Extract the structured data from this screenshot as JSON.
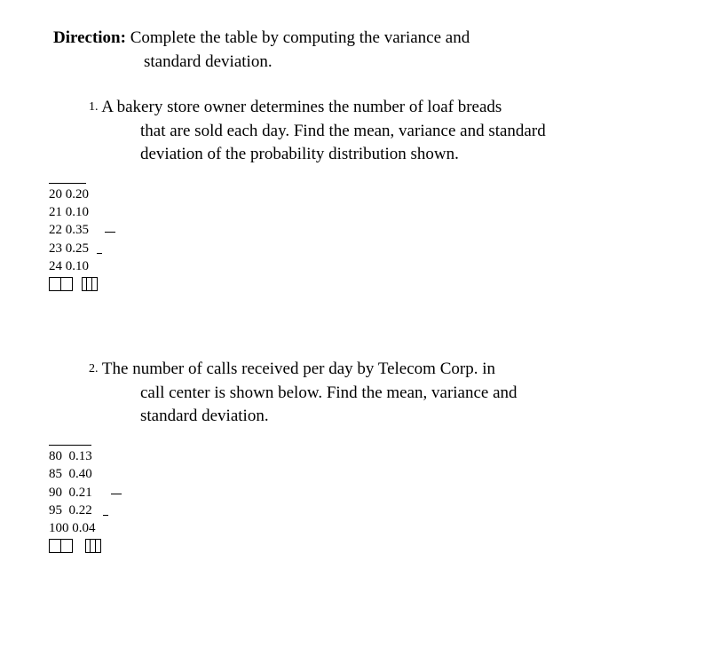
{
  "direction": {
    "label": "Direction:",
    "text1": " Complete the table by computing the variance and",
    "text2": "standard deviation."
  },
  "problems": [
    {
      "num": "1.",
      "text1": " A bakery store owner determines the number of loaf breads",
      "text2": "that are sold each day. Find the mean, variance and standard",
      "text3": "deviation of the probability distribution shown.",
      "data": [
        "20 0.20",
        "21 0.10",
        "22 0.35",
        "23 0.25",
        "24 0.10"
      ]
    },
    {
      "num": "2.",
      "text1": " The number of calls received per day by Telecom Corp. in",
      "text2": "call center is shown below. Find the mean, variance and",
      "text3": "standard deviation.",
      "data": [
        "80  0.13",
        "85  0.40",
        "90  0.21",
        "95  0.22",
        "100 0.04"
      ]
    }
  ]
}
